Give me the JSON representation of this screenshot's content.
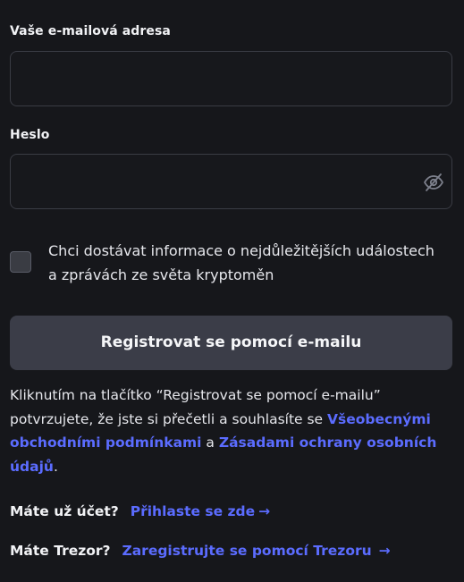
{
  "email": {
    "label": "Vaše e-mailová adresa",
    "value": "",
    "placeholder": ""
  },
  "password": {
    "label": "Heslo",
    "value": "",
    "placeholder": "",
    "visibility_icon": "eye-off-icon"
  },
  "newsletter": {
    "checked": false,
    "line1": "Chci dostávat informace o nejdůležitějších událostech",
    "line2": "a zprávách ze světa kryptoměn"
  },
  "submit": {
    "label": "Registrovat se pomocí e-mailu"
  },
  "legal": {
    "text_before": "Kliknutím na tlačítko “Registrovat se pomocí e-mailu” potvrzujete, že jste si přečetli a souhlasíte se ",
    "terms_link": "Všeobecnými obchodními podmínkami",
    "and": " a ",
    "privacy_link": "Zásadami ochrany osobních údajů",
    "end": "."
  },
  "login": {
    "question": "Máte už účet?",
    "link": "Přihlaste se zde",
    "arrow": "→"
  },
  "trezor": {
    "question": "Máte Trezor?",
    "link": "Zaregistrujte se pomocí Trezoru",
    "arrow": "→"
  },
  "colors": {
    "background": "#16171b",
    "link": "#5b6cff",
    "button": "#3b3d48",
    "border": "#3a3c44"
  }
}
